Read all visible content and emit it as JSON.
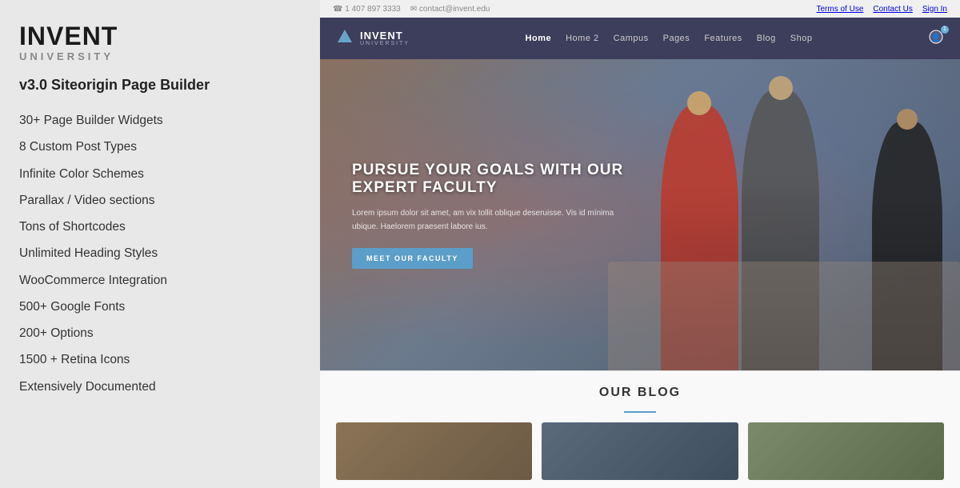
{
  "brand": {
    "title": "INVENT",
    "subtitle": "UNIVERSITY",
    "version": "v3.0 Siteorigin Page Builder"
  },
  "features": [
    "30+ Page Builder Widgets",
    "8 Custom Post Types",
    "Infinite Color Schemes",
    "Parallax / Video sections",
    "Tons of Shortcodes",
    "Unlimited Heading Styles",
    "WooCommerce Integration",
    "500+ Google Fonts",
    "200+ Options",
    "1500 + Retina Icons",
    "Extensively Documented"
  ],
  "topbar": {
    "phone": "1 407 897 3333",
    "email": "contact@invent.edu",
    "links": [
      "Terms of Use",
      "Contact Us",
      "Sign In"
    ]
  },
  "navbar": {
    "brand": "INVENT",
    "brand_sub": "UNIVERSITY",
    "nav_items": [
      "Home",
      "Home 2",
      "Campus",
      "Pages",
      "Features",
      "Blog",
      "Shop"
    ]
  },
  "hero": {
    "headline": "PURSUE YOUR GOALS WITH OUR EXPERT FACULTY",
    "description": "Lorem ipsum dolor sit amet, am vix tollit oblique deseruisse. Vis id mínima ubique. Haelorem praesent labore ius.",
    "button_label": "MEET OUR FACULTY"
  },
  "blog": {
    "title": "OUR BLOG",
    "thumbnails": [
      "brown-desk",
      "dark-corridor",
      "green-exterior"
    ]
  }
}
